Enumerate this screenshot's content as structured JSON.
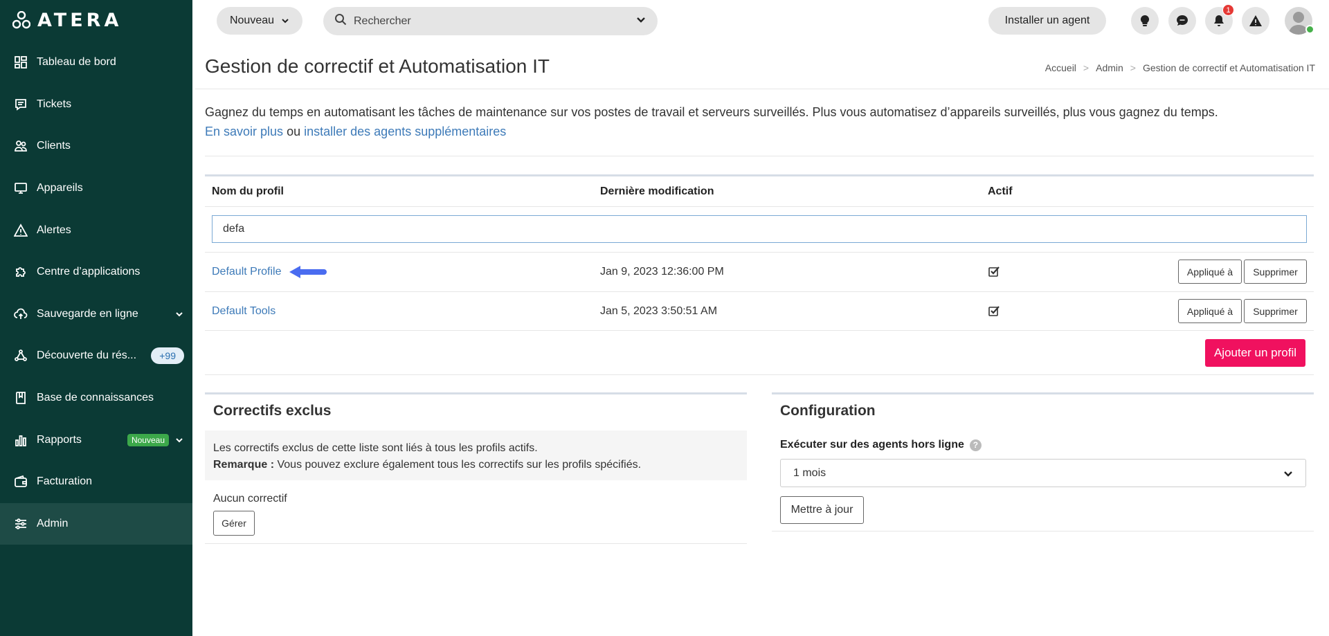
{
  "app": {
    "logo_text": "ATERA"
  },
  "sidebar": {
    "items": [
      {
        "label": "Tableau de bord",
        "icon": "dashboard-icon"
      },
      {
        "label": "Tickets",
        "icon": "ticket-icon"
      },
      {
        "label": "Clients",
        "icon": "clients-icon"
      },
      {
        "label": "Appareils",
        "icon": "monitor-icon"
      },
      {
        "label": "Alertes",
        "icon": "alert-triangle-icon"
      },
      {
        "label": "Centre d’applications",
        "icon": "puzzle-icon"
      },
      {
        "label": "Sauvegarde en ligne",
        "icon": "cloud-upload-icon",
        "has_chevron": true
      },
      {
        "label": "Découverte du rés...",
        "icon": "network-icon",
        "count": "+99"
      },
      {
        "label": "Base de connaissances",
        "icon": "book-icon"
      },
      {
        "label": "Rapports",
        "icon": "bar-chart-icon",
        "badge": "Nouveau",
        "has_chevron": true
      },
      {
        "label": "Facturation",
        "icon": "wallet-icon"
      },
      {
        "label": "Admin",
        "icon": "sliders-icon",
        "active": true
      }
    ]
  },
  "topbar": {
    "new_label": "Nouveau",
    "search_placeholder": "Rechercher",
    "install_label": "Installer un agent",
    "notif_count": "1"
  },
  "page": {
    "title": "Gestion de correctif et Automatisation IT",
    "breadcrumb": [
      "Accueil",
      "Admin",
      "Gestion de correctif et Automatisation IT"
    ],
    "intro": "Gagnez du temps en automatisant les tâches de maintenance sur vos postes de travail et serveurs surveillés. Plus vous automatisez d’appareils surveillés, plus vous gagnez du temps.",
    "link_learn": "En savoir plus",
    "intro_or": "ou",
    "link_install": "installer des agents supplémentaires"
  },
  "table": {
    "headers": {
      "name": "Nom du profil",
      "modified": "Dernière modification",
      "active": "Actif"
    },
    "filter_value": "defa",
    "rows": [
      {
        "name": "Default Profile",
        "modified": "Jan 9, 2023 12:36:00 PM",
        "active": true
      },
      {
        "name": "Default Tools",
        "modified": "Jan 5, 2023 3:50:51 AM",
        "active": true
      }
    ],
    "applied_label": "Appliqué à",
    "delete_label": "Supprimer",
    "add_label": "Ajouter un profil"
  },
  "excluded": {
    "title": "Correctifs exclus",
    "info_line1": "Les correctifs exclus de cette liste sont liés à tous les profils actifs.",
    "info_remark_label": "Remarque :",
    "info_remark_text": "Vous pouvez exclure également tous les correctifs sur les profils spécifiés.",
    "empty_text": "Aucun correctif",
    "manage_label": "Gérer"
  },
  "configuration": {
    "title": "Configuration",
    "offline_label": "Exécuter sur des agents hors ligne",
    "offline_value": "1 mois",
    "update_label": "Mettre à jour"
  },
  "colors": {
    "sidebar_bg": "#0b3a35",
    "accent_pink": "#f0115f",
    "link_blue": "#3d7ab8",
    "annotation_arrow": "#4a6cf0"
  }
}
